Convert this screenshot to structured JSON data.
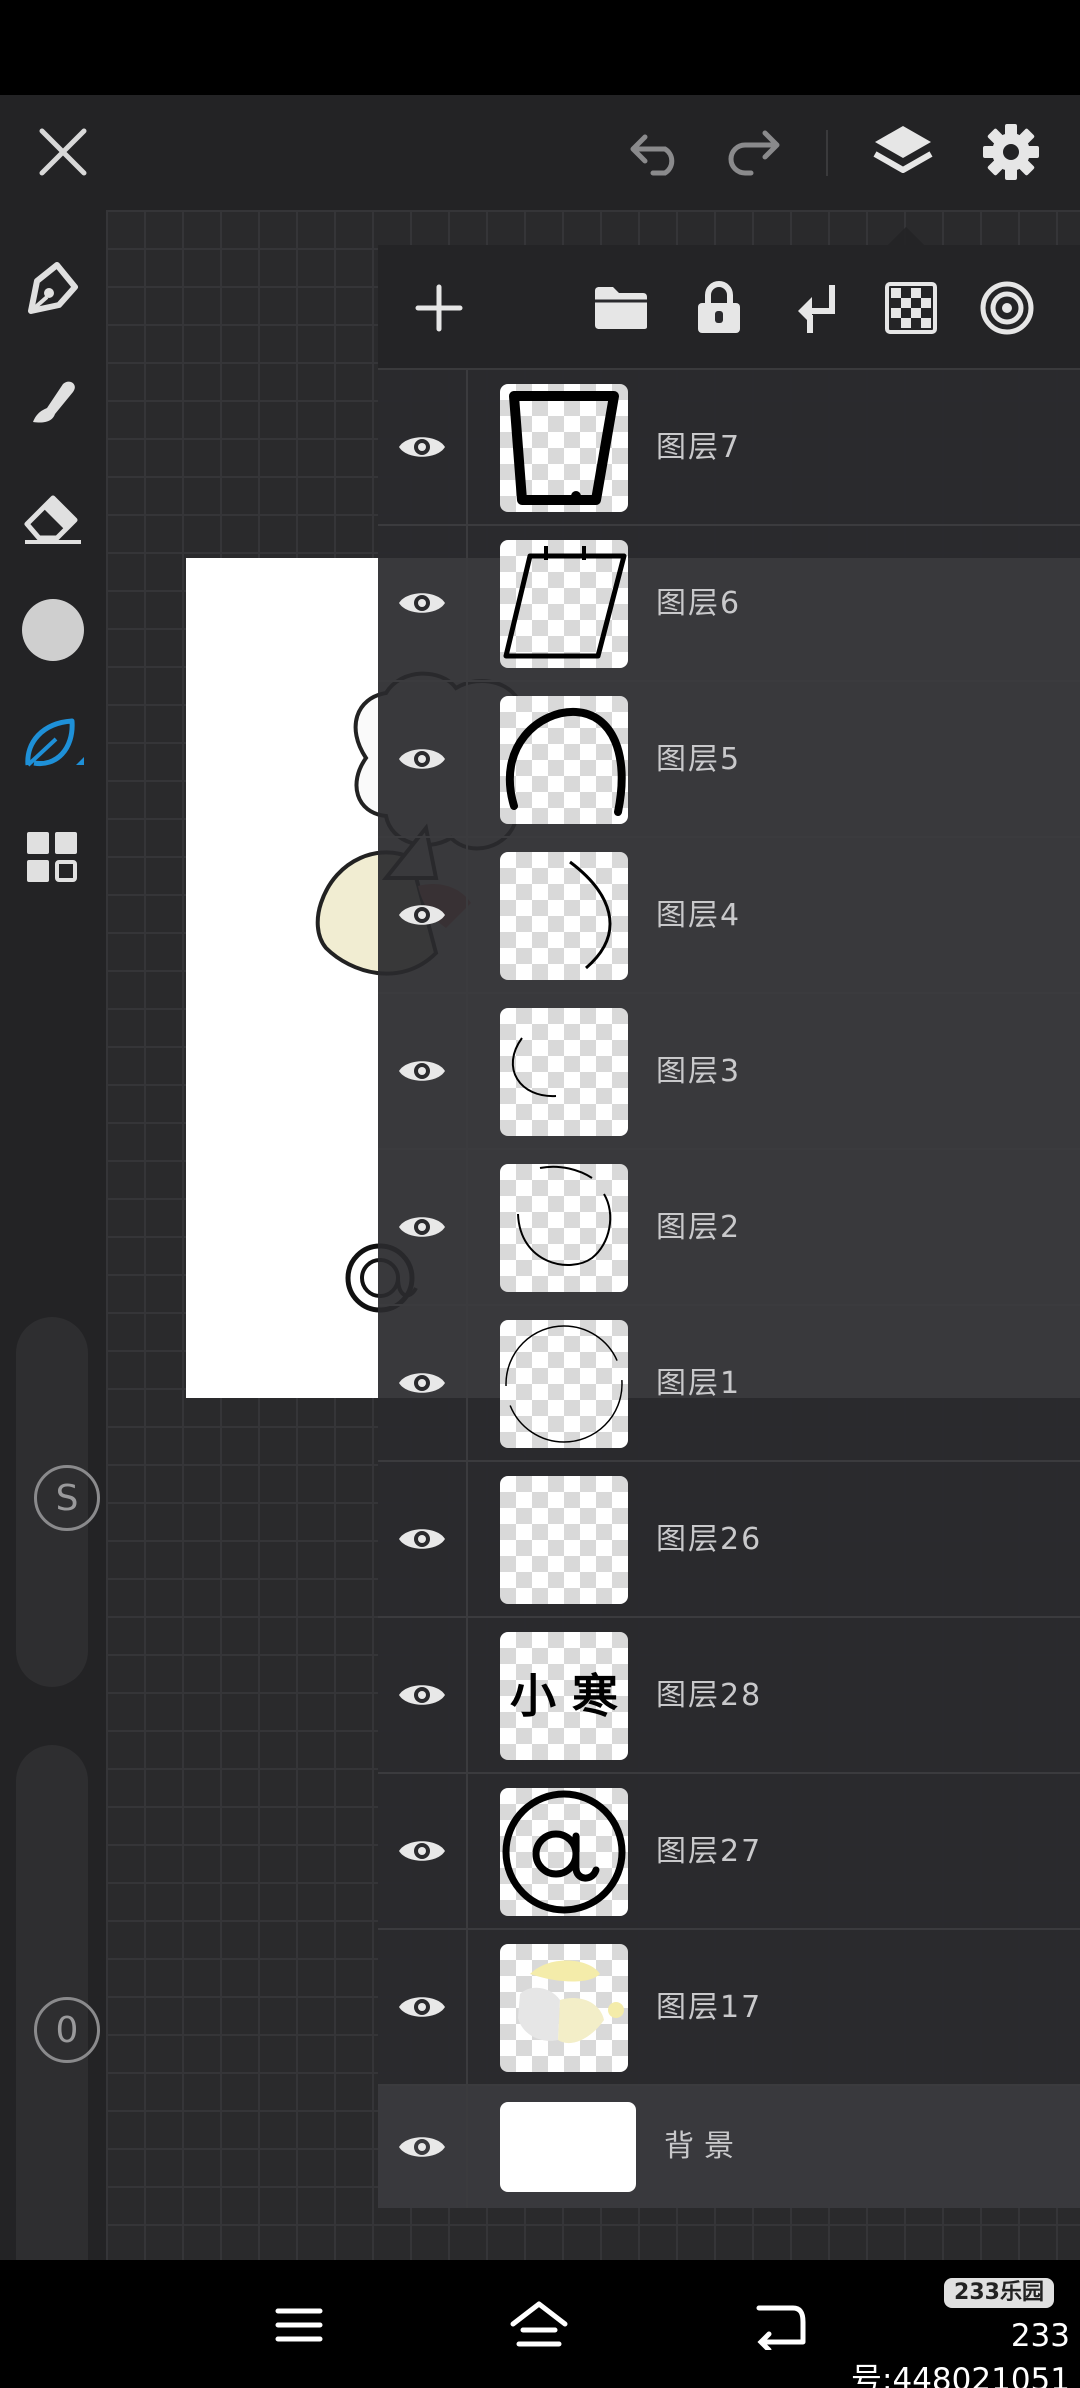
{
  "topbar": {
    "icons": [
      "close-icon",
      "undo-icon",
      "redo-icon",
      "layers-icon",
      "settings-gear-icon"
    ]
  },
  "toolbar": {
    "tools": [
      "pen-icon",
      "smudge-brush-icon",
      "eraser-icon",
      "color-circle-icon",
      "leaf-brush-icon",
      "grid-menu-icon"
    ],
    "active_tool_color": "#1e90d8",
    "size_slider_label": "S",
    "opacity_slider_label": "0"
  },
  "layer_panel": {
    "header_icons": [
      "add-layer-icon",
      "folder-icon",
      "lock-icon",
      "merge-down-icon",
      "checkerboard-icon",
      "target-icon"
    ],
    "layers": [
      {
        "name": "图层7",
        "visible": true
      },
      {
        "name": "图层6",
        "visible": true
      },
      {
        "name": "图层5",
        "visible": true
      },
      {
        "name": "图层4",
        "visible": true
      },
      {
        "name": "图层3",
        "visible": true
      },
      {
        "name": "图层2",
        "visible": true
      },
      {
        "name": "图层1",
        "visible": true
      },
      {
        "name": "图层26",
        "visible": true
      },
      {
        "name": "图层28",
        "visible": true
      },
      {
        "name": "图层27",
        "visible": true
      },
      {
        "name": "图层17",
        "visible": true
      }
    ],
    "background_layer": {
      "name": "背景",
      "visible": true
    },
    "thumb_text_layer28": "小 寒"
  },
  "navbar": {
    "icons": [
      "menu-icon",
      "home-icon",
      "back-icon"
    ],
    "watermark_logo": "233乐园",
    "watermark_id": "233号:448021051"
  }
}
